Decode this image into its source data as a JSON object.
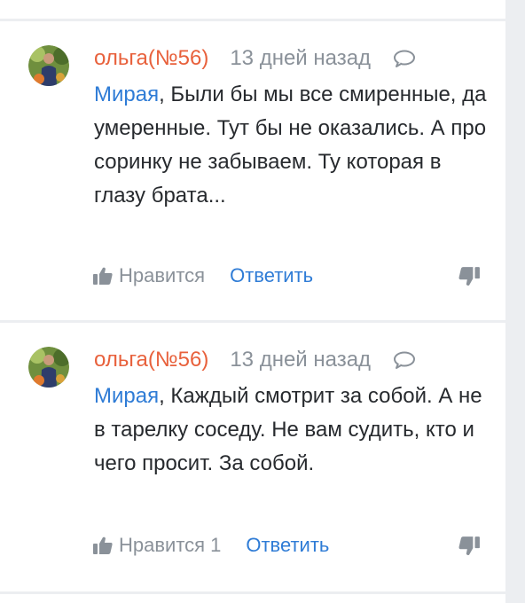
{
  "comments": [
    {
      "author": "ольга(№56)",
      "time": "13 дней назад",
      "mention": "Мирая",
      "text": ", Были бы мы все смиренные, да умеренные. Тут бы не оказались. А про соринку не забываем. Ту которая в глазу брата...",
      "like_label": "Нравится",
      "like_count": "",
      "reply_label": "Ответить"
    },
    {
      "author": "ольга(№56)",
      "time": "13 дней назад",
      "mention": "Мирая",
      "text": ", Каждый смотрит за собой. А не в тарелку соседу. Не вам судить, кто и чего просит. За собой.",
      "like_label": "Нравится",
      "like_count": "1",
      "reply_label": "Ответить"
    }
  ],
  "icons": {
    "reply_bubble": "speech-bubble-icon",
    "like": "thumbs-up-icon",
    "dislike": "thumbs-down-icon"
  },
  "colors": {
    "author": "#e8613c",
    "link": "#2f7cd6",
    "muted": "#8a9199",
    "text": "#272a2e",
    "background": "#eceef1"
  }
}
